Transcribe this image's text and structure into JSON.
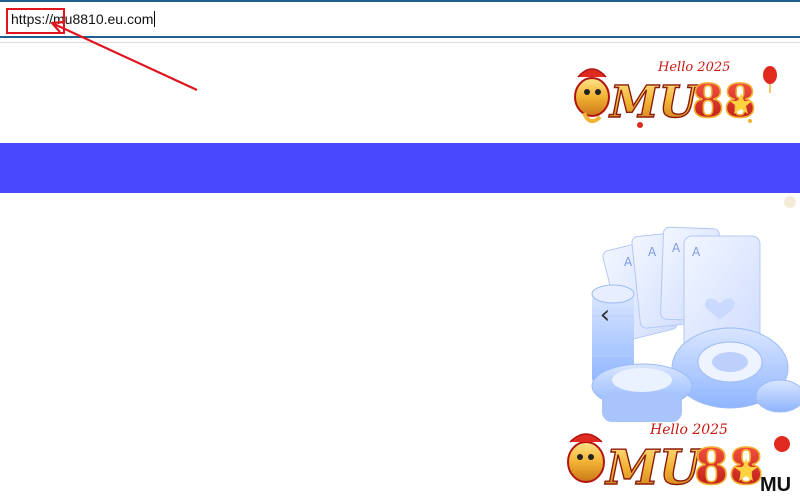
{
  "browser": {
    "address_value": "https://mu8810.eu.com"
  },
  "brand": {
    "logo_text": "MU88",
    "logo_tagline": "Hello 2025",
    "corner_text": "MU"
  },
  "banner": {
    "prev_arrow_icon": "chevron-left-icon"
  },
  "colors": {
    "nav_band": "#4a48ff",
    "annotation": "#e0141e",
    "address_bar_border": "#1f5f8b",
    "logo_red": "#d8231c",
    "logo_gold": "#f2b233",
    "art_blue": "#8fb5ff"
  }
}
